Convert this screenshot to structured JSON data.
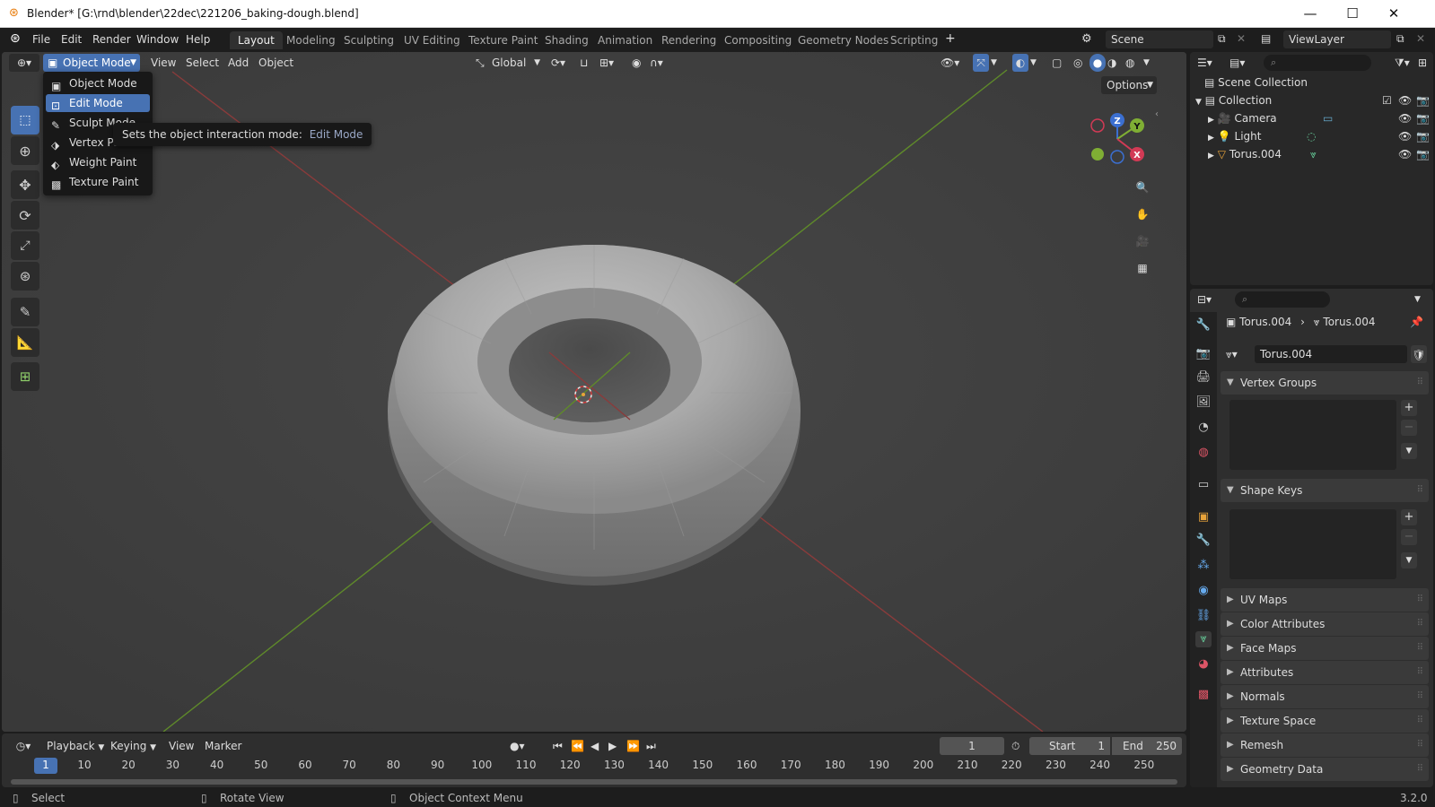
{
  "window": {
    "title": "Blender* [G:\\rnd\\blender\\22dec\\221206_baking-dough.blend]",
    "minimize": "—",
    "maximize": "☐",
    "close": "✕"
  },
  "menu": [
    "File",
    "Edit",
    "Render",
    "Window",
    "Help"
  ],
  "workspaces": [
    "Layout",
    "Modeling",
    "Sculpting",
    "UV Editing",
    "Texture Paint",
    "Shading",
    "Animation",
    "Rendering",
    "Compositing",
    "Geometry Nodes",
    "Scripting"
  ],
  "active_workspace": "Layout",
  "add_workspace": "+",
  "scene": {
    "label": "Scene"
  },
  "view_layer": {
    "label": "ViewLayer"
  },
  "viewport": {
    "mode_label": "Object Mode",
    "menus": [
      "View",
      "Select",
      "Add",
      "Object"
    ],
    "orientation": "Global",
    "options_label": "Options",
    "gizmo": {
      "z": "Z",
      "y": "Y",
      "x": "X"
    }
  },
  "mode_menu": {
    "items": [
      "Object Mode",
      "Edit Mode",
      "Sculpt Mode",
      "Vertex Pa",
      "Weight Paint",
      "Texture Paint"
    ],
    "selected_index": 1
  },
  "tooltip": {
    "text": "Sets the object interaction mode:",
    "value": "Edit Mode"
  },
  "timeline": {
    "menus": [
      "Playback",
      "Keying",
      "View",
      "Marker"
    ],
    "current_frame": "1",
    "start_label": "Start",
    "start_value": "1",
    "end_label": "End",
    "end_value": "250",
    "ticks": [
      "1",
      "10",
      "20",
      "30",
      "40",
      "50",
      "60",
      "70",
      "80",
      "90",
      "100",
      "110",
      "120",
      "130",
      "140",
      "150",
      "160",
      "170",
      "180",
      "190",
      "200",
      "210",
      "220",
      "230",
      "240",
      "250"
    ]
  },
  "outliner": {
    "root": "Scene Collection",
    "collection": "Collection",
    "objects": [
      "Camera",
      "Light",
      "Torus.004"
    ]
  },
  "properties": {
    "breadcrumb_object": "Torus.004",
    "breadcrumb_data": "Torus.004",
    "data_name": "Torus.004",
    "panels_open": [
      "Vertex Groups",
      "Shape Keys"
    ],
    "panels_closed": [
      "UV Maps",
      "Color Attributes",
      "Face Maps",
      "Attributes",
      "Normals",
      "Texture Space",
      "Remesh",
      "Geometry Data"
    ]
  },
  "status": {
    "left": "Select",
    "middle": "Rotate View",
    "right": "Object Context Menu",
    "version": "3.2.0"
  }
}
